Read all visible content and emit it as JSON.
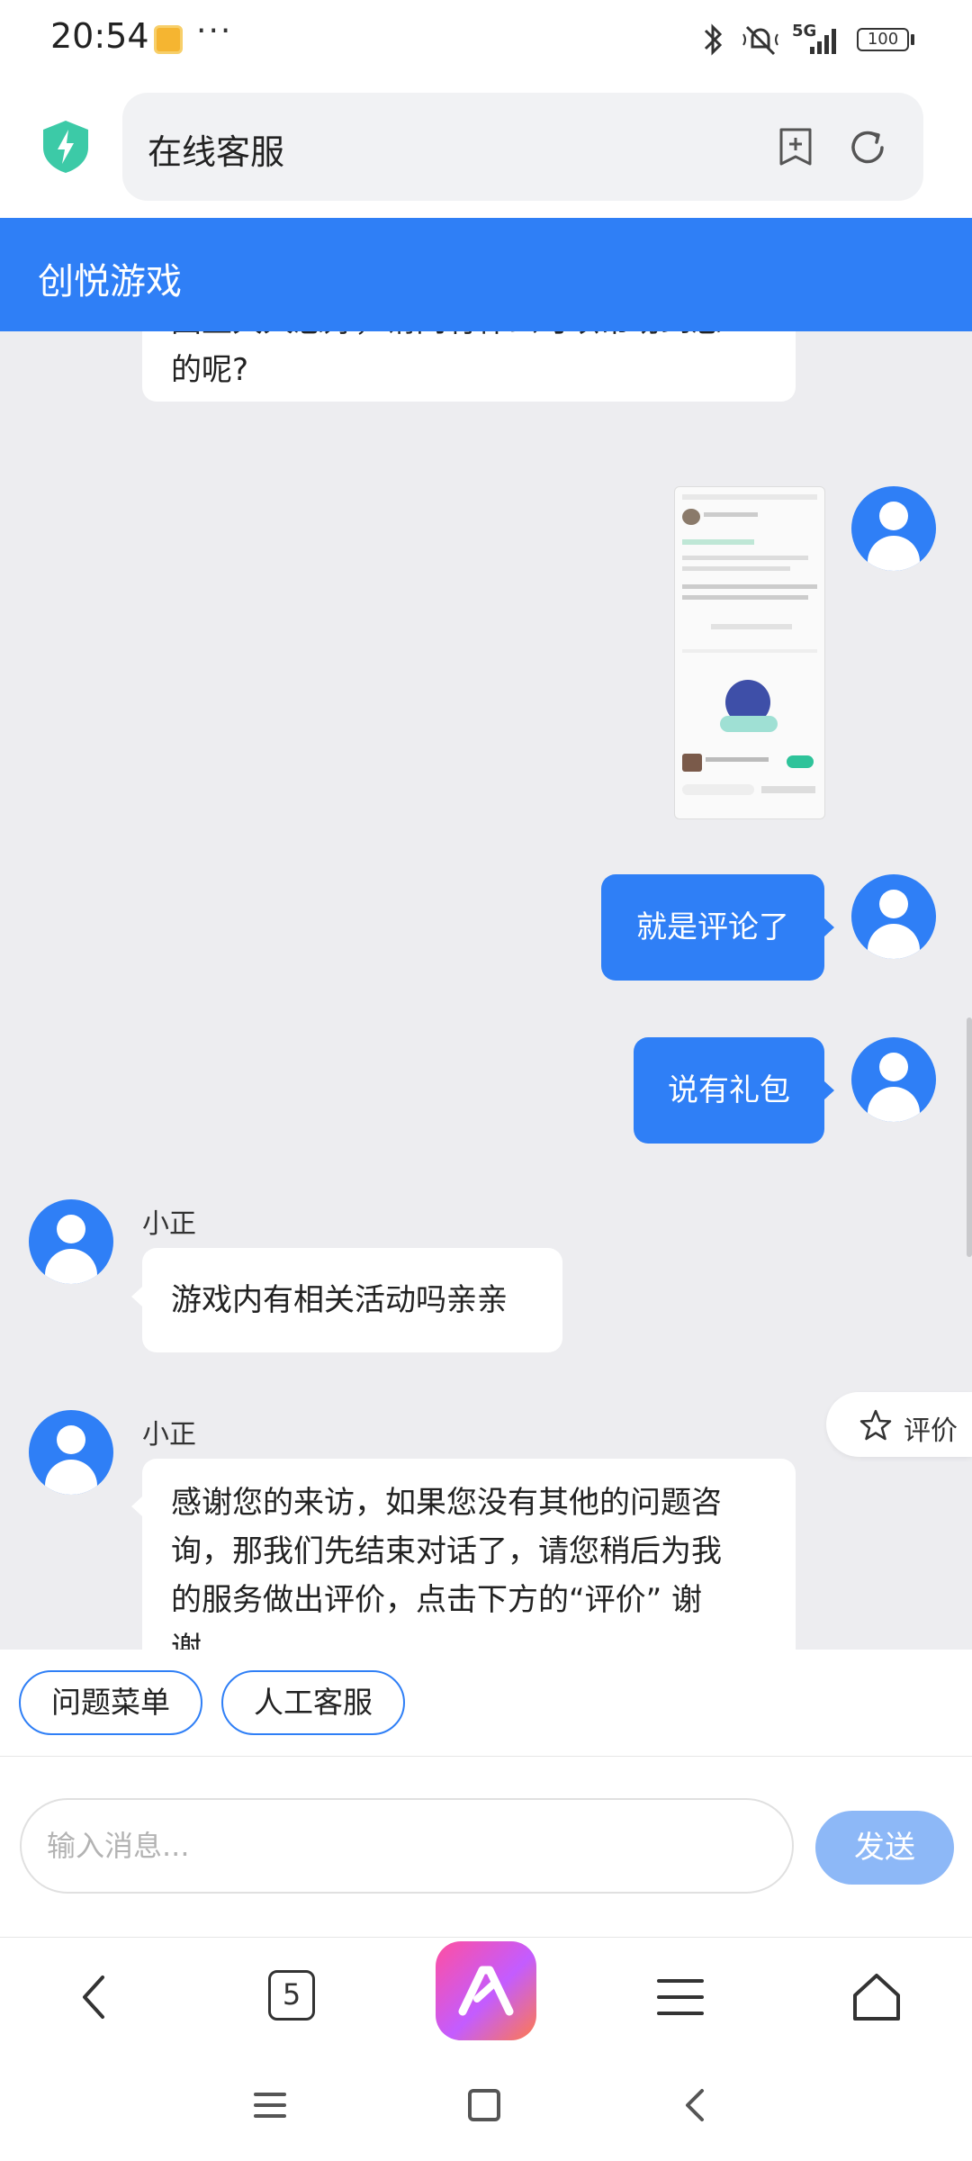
{
  "status_bar": {
    "time": "20:54",
    "more": "···",
    "network": "5G",
    "battery": "100"
  },
  "browser": {
    "address_text": "在线客服",
    "icons": [
      "shield-bolt-icon",
      "add-bookmark-icon",
      "reload-icon"
    ]
  },
  "header": {
    "title": "创悦游戏"
  },
  "chat": {
    "messages": [
      {
        "from": "agent",
        "text": "国王大人您好，请问有什么可以帮助到您的呢?",
        "line1": "国王大人您好，请问有什么可以帮助到您",
        "line2": "的呢?"
      },
      {
        "from": "user",
        "type": "image",
        "icon": "screenshot-thumbnail"
      },
      {
        "from": "user",
        "text": "就是评论了"
      },
      {
        "from": "user",
        "text": "说有礼包"
      },
      {
        "from": "agent",
        "sender": "小正",
        "text": "游戏内有相关活动吗亲亲"
      },
      {
        "from": "agent",
        "sender": "小正",
        "text": "感谢您的来访，如果您没有其他的问题咨询，那我们先结束对话了，请您稍后为我的服务做出评价，点击下方的“评价” 谢谢",
        "line1": "感谢您的来访，如果您没有其他的问题咨",
        "line2": "询，那我们先结束对话了，请您稍后为我",
        "line3": "的服务做出评价，点击下方的“评价” 谢",
        "line4": "谢"
      }
    ],
    "rate_label": "评价"
  },
  "quick_menu": {
    "items": [
      "问题菜单",
      "人工客服"
    ]
  },
  "composer": {
    "placeholder": "输入消息...",
    "send_label": "发送"
  },
  "bottom_nav": {
    "tab_count": "5",
    "icons": [
      "back-icon",
      "tabs-icon",
      "ai-assistant-icon",
      "menu-icon",
      "home-icon"
    ]
  },
  "colors": {
    "primary": "#2f7ff6",
    "send_disabled": "#8db8f7",
    "chat_bg": "#ededf0"
  }
}
